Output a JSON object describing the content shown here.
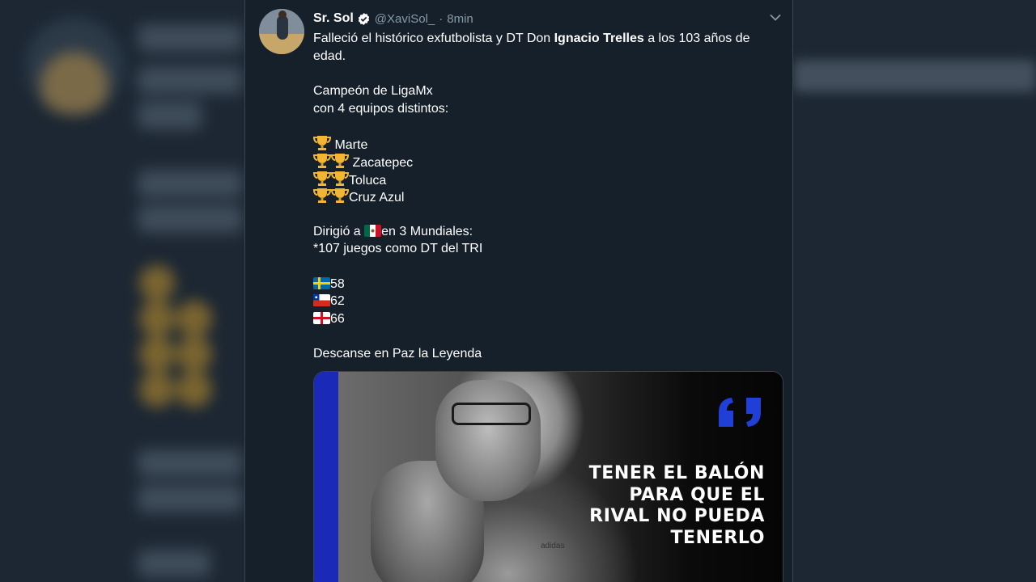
{
  "tweet": {
    "author_name": "Sr. Sol",
    "handle": "@XaviSol_",
    "separator": "·",
    "time": "8min",
    "text": {
      "line1_pre": "Falleció el histórico exfutbolista y DT Don ",
      "line1_bold": "Ignacio Trelles",
      "line1_post": " a los 103 años de",
      "line2": "edad.",
      "line3": "Campeón de LigaMx",
      "line4": "con 4 equipos distintos:",
      "team1": " Marte",
      "team2": " Zacatepec",
      "team3": "Toluca",
      "team4": "Cruz Azul",
      "dirigio_pre": "Dirigió a ",
      "dirigio_post": "en 3 Mundiales:",
      "juegos": "*107 juegos como DT del TRI",
      "wc1": "58",
      "wc2": "62",
      "wc3": "66",
      "closing": "Descanse en Paz la Leyenda"
    },
    "media": {
      "quote_line1": "TENER EL BALÓN",
      "quote_line2": "PARA QUE EL",
      "quote_line3": "RIVAL NO PUEDA",
      "quote_line4": "TENERLO",
      "shirt_text": "adidas",
      "accent_color": "#1a29b8"
    }
  },
  "icons": {
    "verified": "verified-badge-icon",
    "chevron": "chevron-down-icon",
    "trophy": "trophy-icon",
    "quote": "quote-mark-icon"
  }
}
